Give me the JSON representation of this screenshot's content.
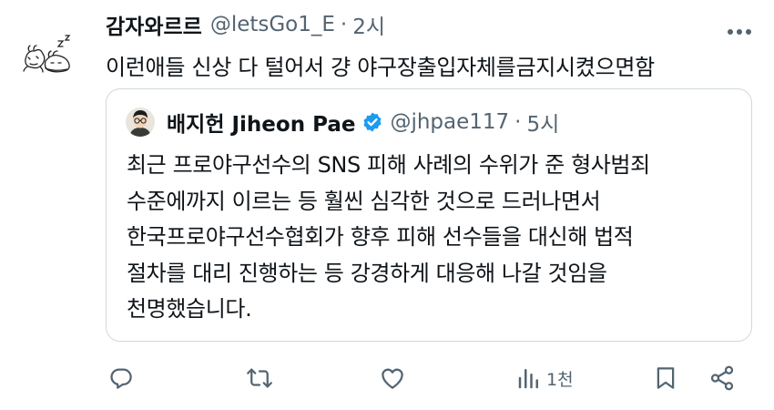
{
  "tweet": {
    "display_name": "감자와르르",
    "handle": "@letsGo1_E",
    "separator": "·",
    "time": "2시",
    "text": "이런애들 신상 다 털어서 걍 야구장출입자체를금지시켰으면함"
  },
  "quote": {
    "display_name": "배지헌 Jiheon Pae",
    "handle": "@jhpae117",
    "separator": "·",
    "time": "5시",
    "lines": [
      "최근 프로야구선수의 SNS 피해 사례의 수위가 준 형사범죄",
      "수준에까지 이르는 등 훨씬 심각한 것으로 드러나면서",
      "한국프로야구선수협회가 향후 피해 선수들을 대신해 법적",
      "절차를 대리 진행하는 등 강경하게 대응해 나갈 것임을",
      "천명했습니다."
    ]
  },
  "actions": {
    "views_count": "1천"
  },
  "colors": {
    "text": "#0f1419",
    "muted": "#536471",
    "border": "#cfd9de",
    "verified": "#1d9bf0"
  },
  "icons": [
    "more-icon",
    "verified-badge-icon",
    "reply-icon",
    "retweet-icon",
    "like-icon",
    "views-icon",
    "bookmark-icon",
    "share-icon"
  ]
}
